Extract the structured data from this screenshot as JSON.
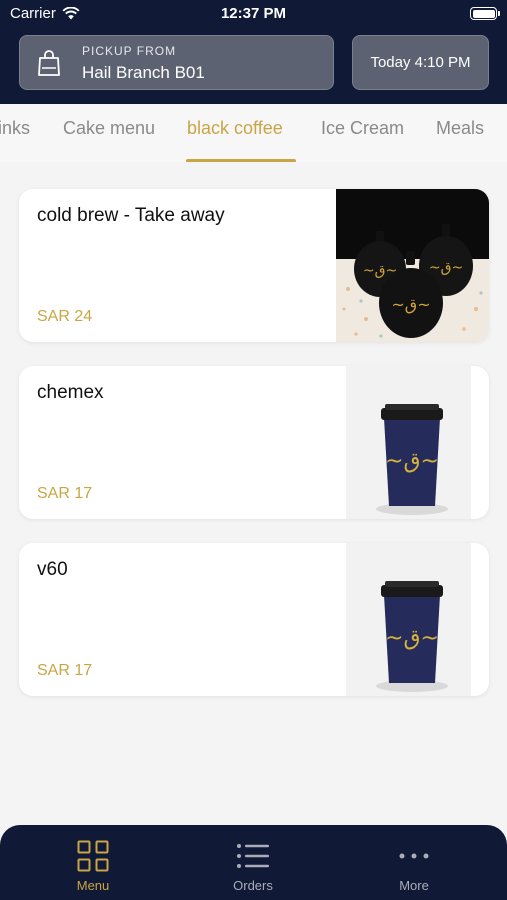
{
  "status_bar": {
    "carrier": "Carrier",
    "time": "12:37 PM"
  },
  "pickup": {
    "label": "PICKUP FROM",
    "branch": "Hail Branch B01",
    "icon": "shopping-bag-icon"
  },
  "pickup_time": "Today 4:10 PM",
  "tabs": [
    {
      "label": "inks",
      "active": false
    },
    {
      "label": "Cake menu",
      "active": false
    },
    {
      "label": "black coffee",
      "active": true
    },
    {
      "label": "Ice Cream",
      "active": false
    },
    {
      "label": "Meals",
      "active": false
    }
  ],
  "products": [
    {
      "name": "cold brew - Take away",
      "price": "SAR 24",
      "image": "black-bottles-image"
    },
    {
      "name": "chemex",
      "price": "SAR 17",
      "image": "navy-coffee-cup-image"
    },
    {
      "name": "v60",
      "price": "SAR 17",
      "image": "navy-coffee-cup-image"
    }
  ],
  "bottom_nav": [
    {
      "label": "Menu",
      "icon": "grid-icon",
      "active": true
    },
    {
      "label": "Orders",
      "icon": "list-icon",
      "active": false
    },
    {
      "label": "More",
      "icon": "more-dots-icon",
      "active": false
    }
  ],
  "colors": {
    "header_bg": "#101935",
    "accent": "#c9a545",
    "pill_bg": "#5d6272"
  }
}
